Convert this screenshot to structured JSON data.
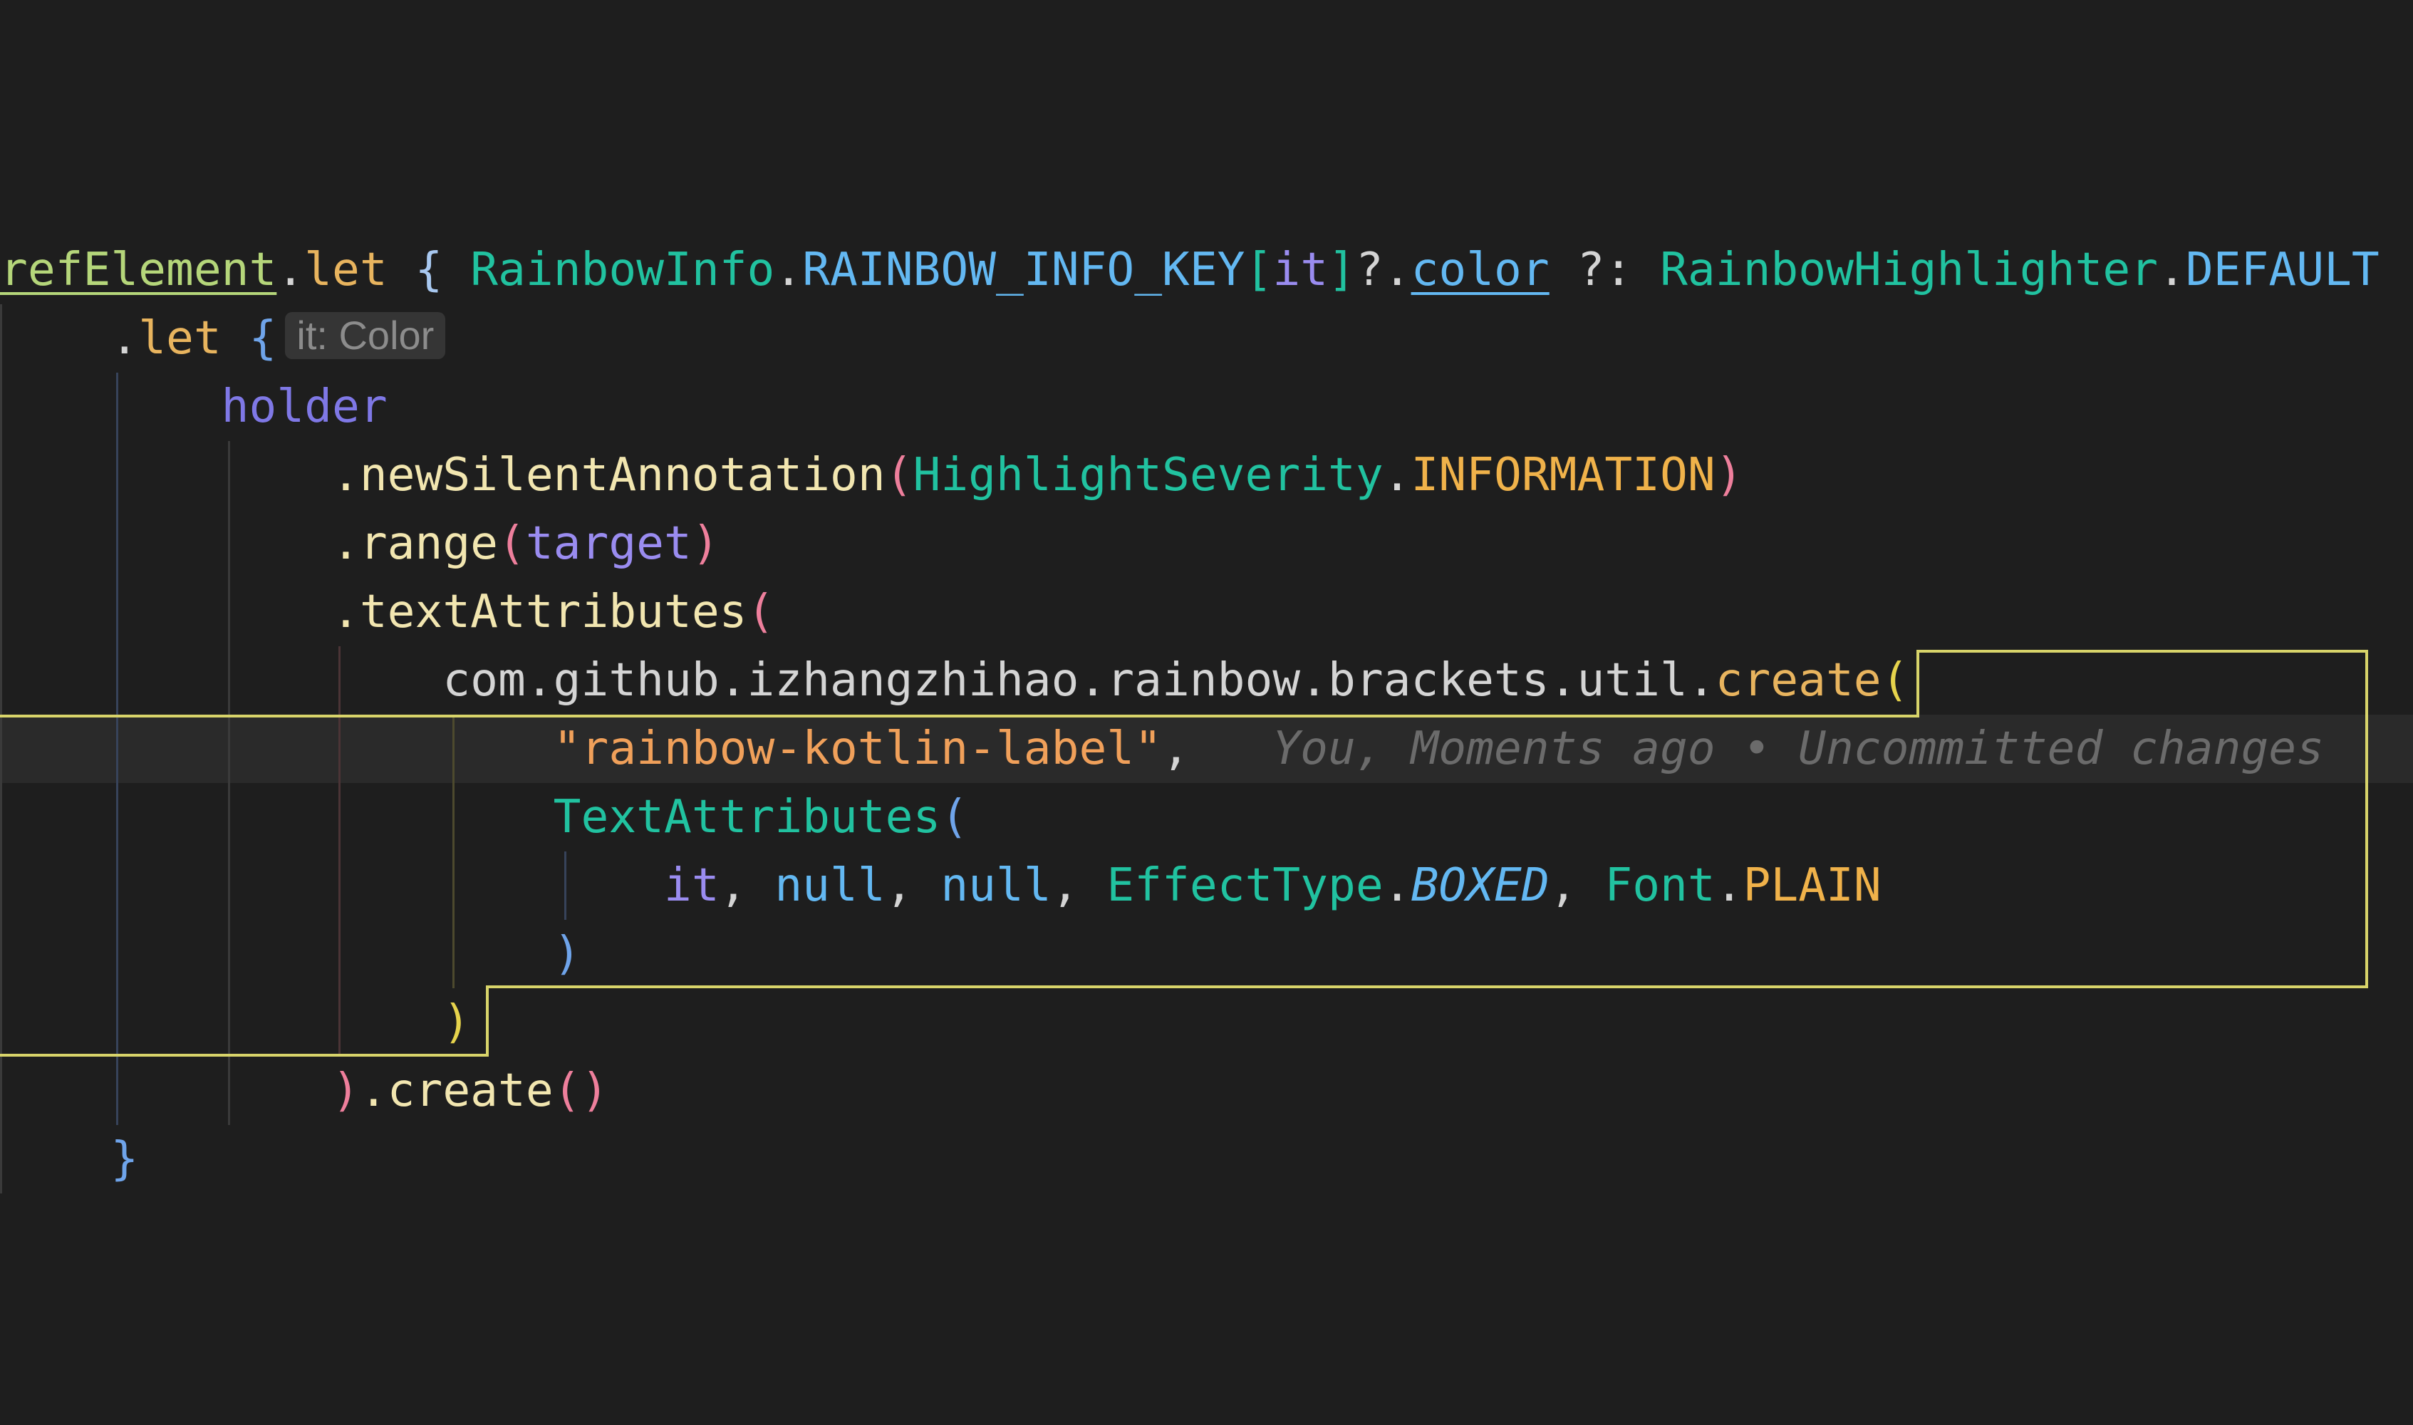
{
  "colors": {
    "background": "#1e1e1e",
    "current_line": "#2a2a2a",
    "text_default": "#d4d4d4",
    "ident_green": "#b5d67a",
    "keyword_orange": "#e8b45e",
    "type_teal": "#21c2a0",
    "constant_blue": "#63b8f2",
    "constant_orange": "#f0b24a",
    "method_cream": "#f2e6b0",
    "variable_purple": "#9a8cf0",
    "holder_indigo": "#7f78e6",
    "string_orange": "#f0a05a",
    "bracket_yellow": "#e6d34c",
    "bracket_pink": "#ee7f9c",
    "bracket_purple": "#c57ee6",
    "bracket_blue": "#6fa4ea",
    "bracket_lightblue": "#a8c8f0",
    "blame_gray": "#6b6b6b",
    "inlay_gray": "#8c8c8c",
    "cursor_outline": "#d8d46a"
  },
  "code": {
    "l0": [
      "refElement",
      ".",
      "let",
      " ",
      "{",
      " ",
      "RainbowInfo",
      ".",
      "RAINBOW_INFO_KEY",
      "[",
      "it",
      "]",
      "?.",
      "color",
      " ?: ",
      "RainbowHighlighter",
      ".",
      "DEFAULT"
    ],
    "l1": [
      "    ",
      ".",
      "let",
      " ",
      "{"
    ],
    "l1_inlay": "it: Color",
    "l2": [
      "        ",
      "holder"
    ],
    "l3": [
      "            ",
      ".newSilentAnnotation",
      "(",
      "HighlightSeverity",
      ".",
      "INFORMATION",
      ")"
    ],
    "l4": [
      "            ",
      ".range",
      "(",
      "target",
      ")"
    ],
    "l5": [
      "            ",
      ".textAttributes",
      "("
    ],
    "l6": [
      "                ",
      "com.github.izhangzhihao.rainbow.brackets.util.",
      "create",
      "("
    ],
    "l7": [
      "                    ",
      "\"rainbow-kotlin-label\"",
      ",",
      "   "
    ],
    "l7_blame": "You, Moments ago • Uncommitted changes",
    "l8": [
      "                    ",
      "TextAttributes",
      "("
    ],
    "l9": [
      "                        ",
      "it",
      ", ",
      "null",
      ", ",
      "null",
      ", ",
      "EffectType",
      ".",
      "BOXED",
      ", ",
      "Font",
      ".",
      "PLAIN"
    ],
    "l10": [
      "                    ",
      ")"
    ],
    "l11": [
      "                ",
      ")"
    ],
    "l12": [
      "            ",
      ")",
      ".create",
      "(",
      ")"
    ],
    "l13": [
      "    ",
      "}"
    ]
  }
}
